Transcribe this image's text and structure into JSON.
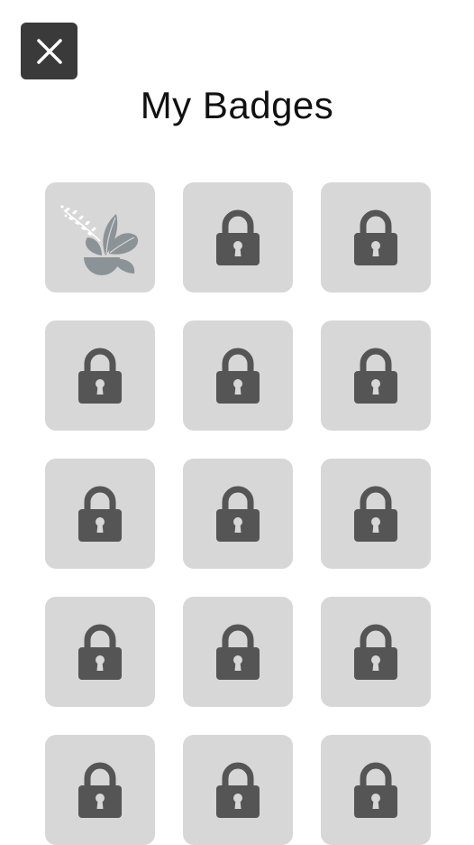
{
  "header": {
    "title": "My Badges",
    "close_icon": "close-icon"
  },
  "colors": {
    "close_bg": "#3a3a3a",
    "tile_bg": "#d7d7d7",
    "lock": "#555555",
    "plant": "#8b9396"
  },
  "badges": [
    {
      "status": "unlocked",
      "icon": "plant-icon"
    },
    {
      "status": "locked",
      "icon": "lock-icon"
    },
    {
      "status": "locked",
      "icon": "lock-icon"
    },
    {
      "status": "locked",
      "icon": "lock-icon"
    },
    {
      "status": "locked",
      "icon": "lock-icon"
    },
    {
      "status": "locked",
      "icon": "lock-icon"
    },
    {
      "status": "locked",
      "icon": "lock-icon"
    },
    {
      "status": "locked",
      "icon": "lock-icon"
    },
    {
      "status": "locked",
      "icon": "lock-icon"
    },
    {
      "status": "locked",
      "icon": "lock-icon"
    },
    {
      "status": "locked",
      "icon": "lock-icon"
    },
    {
      "status": "locked",
      "icon": "lock-icon"
    },
    {
      "status": "locked",
      "icon": "lock-icon"
    },
    {
      "status": "locked",
      "icon": "lock-icon"
    },
    {
      "status": "locked",
      "icon": "lock-icon"
    }
  ]
}
